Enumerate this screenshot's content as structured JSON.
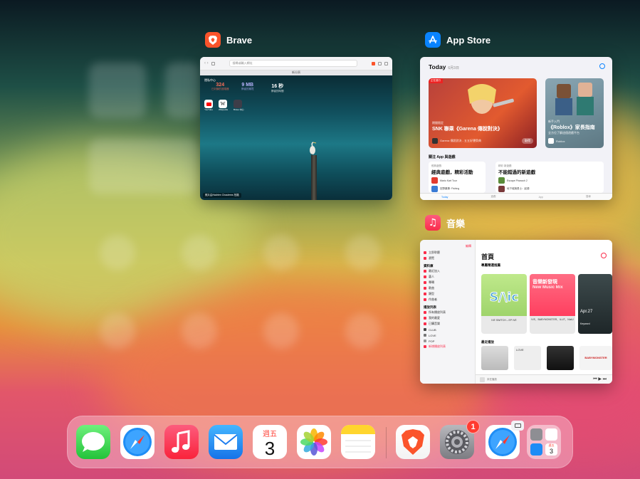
{
  "switcher": {
    "brave": {
      "app_name": "Brave",
      "address_placeholder": "搜尋或輸入網址",
      "tab_title": "新分頁",
      "stats": [
        {
          "value": "324",
          "label": "已封鎖的追蹤器"
        },
        {
          "value": "9 MB",
          "label": "節省的頻寬"
        },
        {
          "value": "16 秒",
          "label": "節省的時間"
        }
      ],
      "privacy_hub_label": "隱私中心",
      "shortcuts": [
        "YouTube",
        "Wikipedia",
        "Brave 中心"
      ],
      "photo_credit": "照片由Hadrien Chautems 拍攝"
    },
    "appstore": {
      "app_name": "App Store",
      "today_label": "Today",
      "date": "6月3日",
      "hero1": {
        "badge": "正在進行",
        "kicker": "期間限定",
        "title": "SNK 聯乘《Garena 傳說對決》",
        "app_line": "Garena 傳說對決 - 五五好運祭典",
        "button": "取得"
      },
      "hero2": {
        "kicker": "新手入門",
        "title": "《Roblox》家長指南",
        "subtitle": "全方位了解這個遊戲平台",
        "app_name": "Roblox"
      },
      "section_title": "關注 App 與遊戲",
      "panel1": {
        "kicker": "經典遊戲",
        "title": "經典遊戲，精彩活動",
        "apps": [
          "Mario Kart Tour",
          "狂野飆車: Fishing"
        ]
      },
      "panel2": {
        "kicker": "精彩 新遊戲",
        "title": "不能錯過的新遊戲",
        "apps": [
          "Escape Pharaoh 2",
          "地下城與勇士：起源"
        ]
      },
      "tabs": [
        "Today",
        "遊戲",
        "App",
        "搜尋"
      ]
    },
    "music": {
      "app_name": "音樂",
      "edit_label": "編輯",
      "sidebar_top": [
        "立即聆聽",
        "瀏覽"
      ],
      "library_head": "資料庫",
      "library_items": [
        "最近加入",
        "藝人",
        "專輯",
        "歌曲",
        "類型",
        "作曲者"
      ],
      "playlists_head": "播放列表",
      "playlist_items": [
        "所有播放列表",
        "我的最愛",
        "已購音樂",
        "CLUB",
        "LOVE",
        "POP"
      ],
      "new_playlist": "新增播放列表",
      "page_title": "首頁",
      "featured_head": "專屬精選推薦",
      "tiles": [
        {
          "caption": "IVE SWITCH",
          "sub": "IVE SWITCH – EP\nIVE"
        },
        {
          "caption": "音樂新發現",
          "sub": "New Music Mix",
          "desc": "IVE、BABYMONSTER、ILLIT、NiziU"
        },
        {
          "caption": "Apr.27",
          "sub": "Keyword"
        }
      ],
      "recent_head": "最近播放",
      "recent_items": [
        "",
        "LOVE",
        "",
        "BABYMONSTER"
      ],
      "now_playing": "未在播放"
    }
  },
  "dock": {
    "apps": [
      {
        "name": "訊息"
      },
      {
        "name": "Safari"
      },
      {
        "name": "音樂"
      },
      {
        "name": "郵件"
      },
      {
        "name": "行事曆",
        "weekday": "週五",
        "day": "3"
      },
      {
        "name": "照片"
      },
      {
        "name": "備忘錄"
      },
      {
        "name": "Brave"
      },
      {
        "name": "設定",
        "badge": "1"
      },
      {
        "name": "Safari"
      },
      {
        "name": "App 資料庫",
        "mini_calendar_day": "3",
        "mini_calendar_weekday": "週五"
      }
    ]
  },
  "colors": {
    "brave_orange": "#fb542b",
    "appstore_blue": "#0a84ff",
    "music_red": "#fb2d4b",
    "badge_red": "#ff3b30"
  }
}
